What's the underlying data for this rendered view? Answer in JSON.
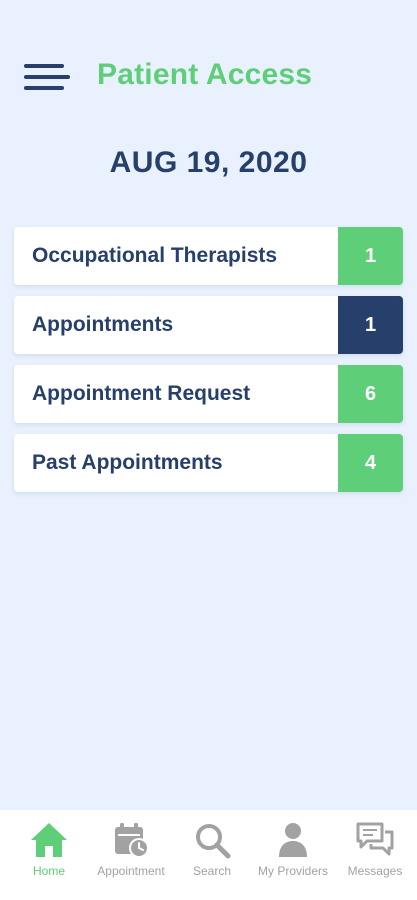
{
  "header": {
    "menu_icon": "hamburger-menu-icon",
    "title": "Patient Access"
  },
  "date": "AUG 19, 2020",
  "list": [
    {
      "label": "Occupational Therapists",
      "count": "1",
      "badge_color": "#5fce78"
    },
    {
      "label": "Appointments",
      "count": "1",
      "badge_color": "#263f6b"
    },
    {
      "label": "Appointment Request",
      "count": "6",
      "badge_color": "#5fce78"
    },
    {
      "label": "Past Appointments",
      "count": "4",
      "badge_color": "#5fce78"
    }
  ],
  "tabs": [
    {
      "label": "Home",
      "icon": "home-icon",
      "active": true
    },
    {
      "label": "Appointment",
      "icon": "calendar-clock-icon",
      "active": false
    },
    {
      "label": "Search",
      "icon": "search-icon",
      "active": false
    },
    {
      "label": "My Providers",
      "icon": "person-icon",
      "active": false
    },
    {
      "label": "Messages",
      "icon": "chat-bubbles-icon",
      "active": false
    }
  ],
  "colors": {
    "primary_green": "#5fce78",
    "navy": "#263f6b",
    "background": "#e8f1fd",
    "inactive_gray": "#a2a2a2"
  }
}
